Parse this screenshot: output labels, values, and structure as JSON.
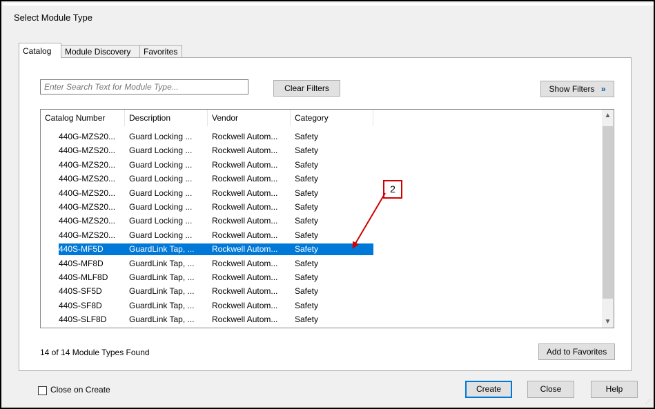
{
  "window": {
    "title": "Select Module Type"
  },
  "tabs": [
    {
      "label": "Catalog",
      "active": true
    },
    {
      "label": "Module Discovery",
      "active": false
    },
    {
      "label": "Favorites",
      "active": false
    }
  ],
  "search": {
    "placeholder": "Enter Search Text for Module Type..."
  },
  "buttons": {
    "clear_filters": "Clear Filters",
    "show_filters": "Show Filters",
    "show_filters_icon": "double-chevron-down-icon",
    "add_to_favorites": "Add to Favorites",
    "create": "Create",
    "close": "Close",
    "help": "Help"
  },
  "table": {
    "columns": [
      "Catalog Number",
      "Description",
      "Vendor",
      "Category"
    ],
    "rows": [
      [
        "440G-MZS20...",
        "Guard Locking ...",
        "Rockwell Autom...",
        "Safety"
      ],
      [
        "440G-MZS20...",
        "Guard Locking ...",
        "Rockwell Autom...",
        "Safety"
      ],
      [
        "440G-MZS20...",
        "Guard Locking ...",
        "Rockwell Autom...",
        "Safety"
      ],
      [
        "440G-MZS20...",
        "Guard Locking ...",
        "Rockwell Autom...",
        "Safety"
      ],
      [
        "440G-MZS20...",
        "Guard Locking ...",
        "Rockwell Autom...",
        "Safety"
      ],
      [
        "440G-MZS20...",
        "Guard Locking ...",
        "Rockwell Autom...",
        "Safety"
      ],
      [
        "440G-MZS20...",
        "Guard Locking ...",
        "Rockwell Autom...",
        "Safety"
      ],
      [
        "440G-MZS20...",
        "Guard Locking ...",
        "Rockwell Autom...",
        "Safety"
      ],
      [
        "440S-MF5D",
        "GuardLink Tap, ...",
        "Rockwell Autom...",
        "Safety"
      ],
      [
        "440S-MF8D",
        "GuardLink Tap, ...",
        "Rockwell Autom...",
        "Safety"
      ],
      [
        "440S-MLF8D",
        "GuardLink Tap, ...",
        "Rockwell Autom...",
        "Safety"
      ],
      [
        "440S-SF5D",
        "GuardLink Tap, ...",
        "Rockwell Autom...",
        "Safety"
      ],
      [
        "440S-SF8D",
        "GuardLink Tap, ...",
        "Rockwell Autom...",
        "Safety"
      ],
      [
        "440S-SLF8D",
        "GuardLink Tap, ...",
        "Rockwell Autom...",
        "Safety"
      ]
    ],
    "selected_index": 8
  },
  "status": {
    "found": "14 of 14 Module Types Found"
  },
  "close_on_create": {
    "label": "Close on Create",
    "checked": false
  },
  "annotation": {
    "callout": "2"
  },
  "colors": {
    "selection": "#0078d7",
    "callout": "#d00000"
  }
}
